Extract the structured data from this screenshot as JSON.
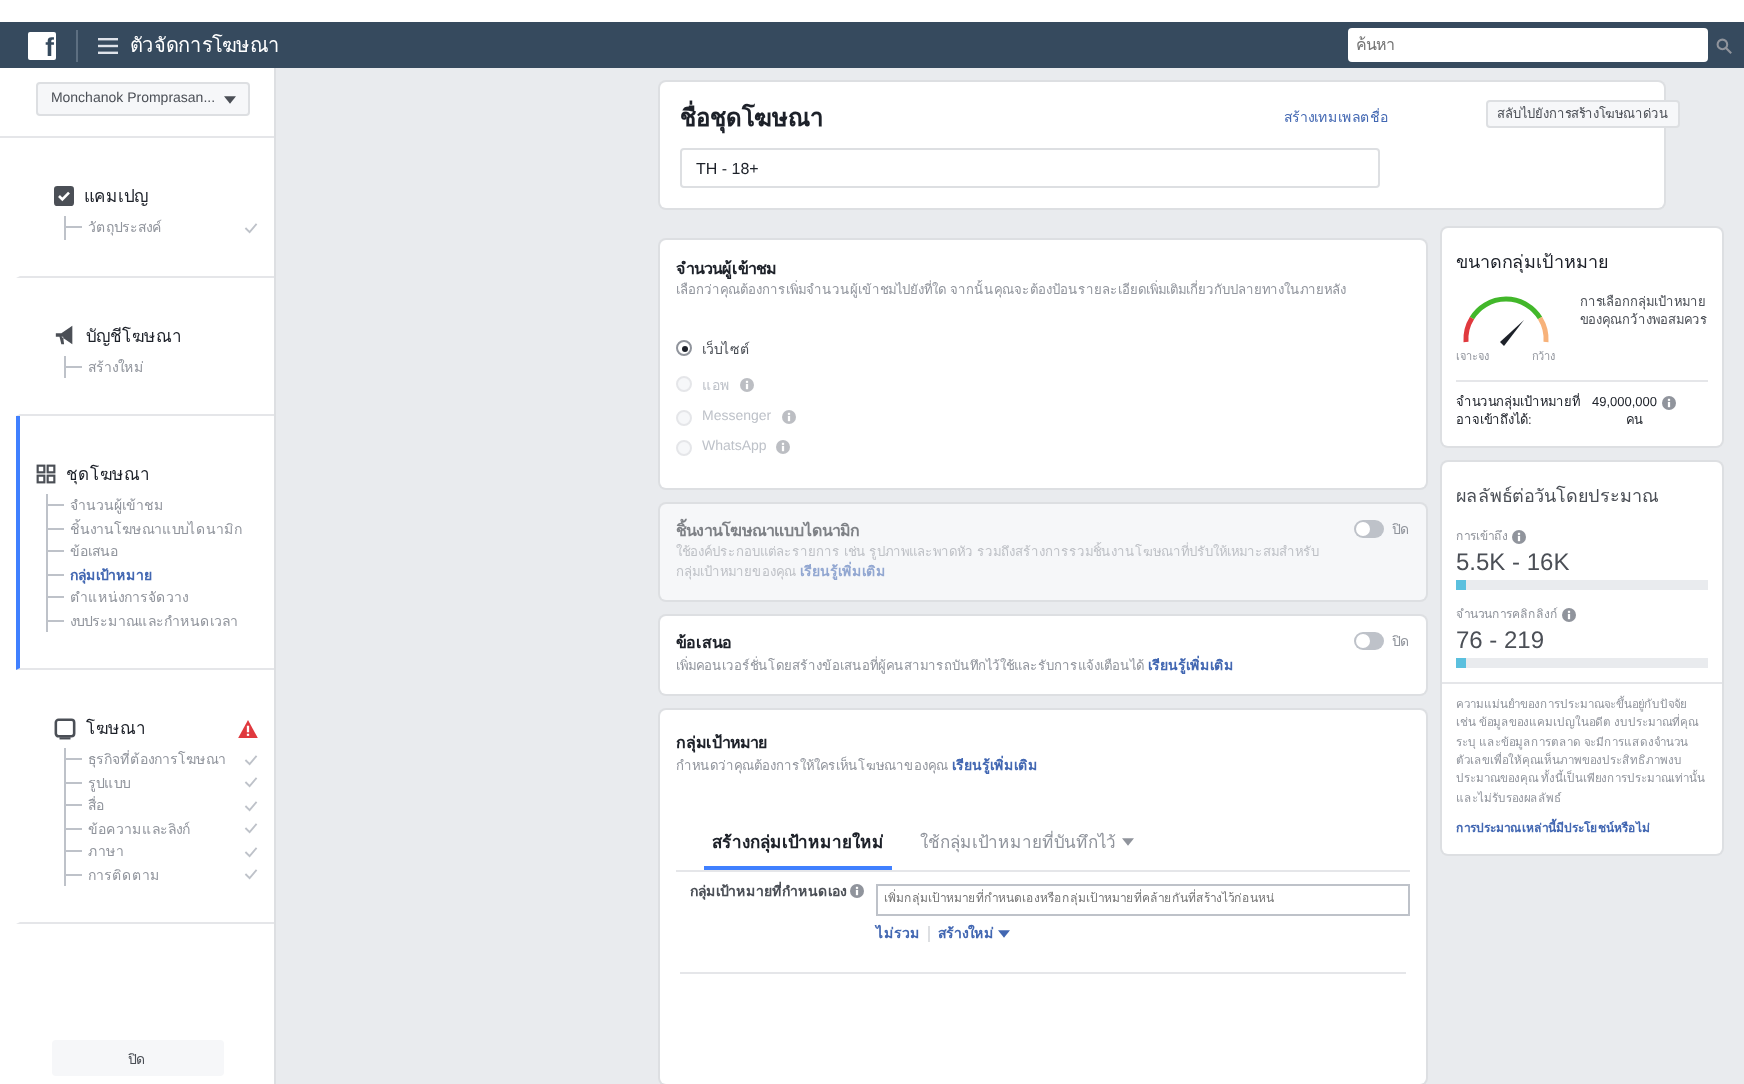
{
  "top_bar": {
    "logo": "f",
    "title": "ตัวจัดการโฆษณา",
    "search": {
      "placeholder": "ค้นหา"
    }
  },
  "sidebar": {
    "account": "Monchanok Promprasan...",
    "sections": [
      {
        "kind": "campaign",
        "title": "แคมเปญ",
        "selected": false,
        "warning": false,
        "items": [
          {
            "label": "วัตถุประสงค์",
            "selected": false,
            "checked": true
          }
        ]
      },
      {
        "kind": "account",
        "title": "บัญชีโฆษณา",
        "selected": false,
        "warning": false,
        "items": [
          {
            "label": "สร้างใหม่",
            "selected": false,
            "checked": false
          }
        ]
      },
      {
        "kind": "adset",
        "title": "ชุดโฆษณา",
        "selected": true,
        "warning": false,
        "items": [
          {
            "label": "จำนวนผู้เข้าชม",
            "selected": false,
            "checked": false
          },
          {
            "label": "ชิ้นงานโฆษณาแบบไดนามิก",
            "selected": false,
            "checked": false
          },
          {
            "label": "ข้อเสนอ",
            "selected": false,
            "checked": false
          },
          {
            "label": "กลุ่มเป้าหมาย",
            "selected": true,
            "checked": false
          },
          {
            "label": "ตำแหน่งการจัดวาง",
            "selected": false,
            "checked": false
          },
          {
            "label": "งบประมาณและกำหนดเวลา",
            "selected": false,
            "checked": false
          }
        ]
      },
      {
        "kind": "ad",
        "title": "โฆษณา",
        "selected": false,
        "warning": true,
        "items": [
          {
            "label": "ธุรกิจที่ต้องการโฆษณา",
            "selected": false,
            "checked": true
          },
          {
            "label": "รูปแบบ",
            "selected": false,
            "checked": true
          },
          {
            "label": "สื่อ",
            "selected": false,
            "checked": true
          },
          {
            "label": "ข้อความและลิงก์",
            "selected": false,
            "checked": true
          },
          {
            "label": "ภาษา",
            "selected": false,
            "checked": true
          },
          {
            "label": "การติดตาม",
            "selected": false,
            "checked": true
          }
        ]
      }
    ],
    "close_button": "ปิด"
  },
  "ad_set_name": {
    "title": "ชื่อชุดโฆษณา",
    "template_link": "สร้างเทมเพลตชื่อ",
    "quick_create_button": "สลับไปยังการสร้างโฆษณาด่วน",
    "value": "TH - 18+"
  },
  "traffic": {
    "title": "จำนวนผู้เข้าชม",
    "description": "เลือกว่าคุณต้องการเพิ่มจำนวนผู้เข้าชมไปยังที่ใด จากนั้นคุณจะต้องป้อนรายละเอียดเพิ่มเติมเกี่ยวกับปลายทางในภายหลัง",
    "options": [
      {
        "label": "เว็บไซต์",
        "selected": true,
        "info": false,
        "disabled": false
      },
      {
        "label": "แอพ",
        "selected": false,
        "info": true,
        "disabled": true
      },
      {
        "label": "Messenger",
        "selected": false,
        "info": true,
        "disabled": true
      },
      {
        "label": "WhatsApp",
        "selected": false,
        "info": true,
        "disabled": true
      }
    ]
  },
  "toggle_cards": [
    {
      "title": "ชิ้นงานโฆษณาแบบไดนามิก",
      "description": "ใช้องค์ประกอบแต่ละรายการ เช่น รูปภาพและพาดหัว รวมถึงสร้างการรวมชิ้นงานโฆษณาที่ปรับให้เหมาะสมสำหรับกลุ่มเป้าหมายของคุณ",
      "link": "เรียนรู้เพิ่มเติม",
      "toggle_label": "ปิด",
      "on": false,
      "disabled": true
    },
    {
      "title": "ข้อเสนอ",
      "description": "เพิ่มคอนเวอร์ชั่นโดยสร้างข้อเสนอที่ผู้คนสามารถบันทึกไว้ใช้และรับการแจ้งเตือนได้",
      "link": "เรียนรู้เพิ่มเติม",
      "toggle_label": "ปิด",
      "on": false,
      "disabled": false
    }
  ],
  "audience": {
    "title": "กลุ่มเป้าหมาย",
    "description": "กำหนดว่าคุณต้องการให้ใครเห็นโฆษณาของคุณ",
    "link": "เรียนรู้เพิ่มเติม",
    "tabs": [
      {
        "label": "สร้างกลุ่มเป้าหมายใหม่",
        "selected": true,
        "dropdown": false
      },
      {
        "label": "ใช้กลุ่มเป้าหมายที่บันทึกไว้",
        "selected": false,
        "dropdown": true
      }
    ],
    "custom_audience": {
      "label": "กลุ่มเป้าหมายที่กำหนดเอง",
      "placeholder": "เพิ่มกลุ่มเป้าหมายที่กำหนดเองหรือกลุ่มเป้าหมายที่คล้ายกันที่สร้างไว้ก่อนหน่",
      "links": [
        {
          "label": "ไม่รวม",
          "dropdown": false
        },
        {
          "label": "สร้างใหม่",
          "dropdown": true
        }
      ]
    }
  },
  "audience_size": {
    "title": "ขนาดกลุ่มเป้าหมาย",
    "gauge_labels": [
      "เจาะจง",
      "กว้าง"
    ],
    "summary": "การเลือกกลุ่มเป้าหมายของคุณกว้างพอสมควร",
    "potential_reach": {
      "label": "จำนวนกลุ่มเป้าหมายที่อาจเข้าถึงได้:",
      "value": "49,000,000",
      "unit": "คน"
    }
  },
  "estimated_results": {
    "title": "ผลลัพธ์ต่อวันโดยประมาณ",
    "metrics": [
      {
        "label": "การเข้าถึง",
        "value": "5.5K - 16K",
        "level": 0.04
      },
      {
        "label": "จำนวนการคลิกลิงก์",
        "value": "76 - 219",
        "level": 0.04
      }
    ],
    "disclaimer": "ความแม่นยำของการประมาณจะขึ้นอยู่กับปัจจัย เช่น ข้อมูลของแคมเปญในอดีต งบประมาณที่คุณระบุ และข้อมูลการตลาด จะมีการแสดงจำนวนตัวเลขเพื่อให้คุณเห็นภาพของประสิทธิภาพงบประมาณของคุณ ทั้งนี้เป็นเพียงการประมาณเท่านั้นและไม่รับรองผลลัพธ์",
    "feedback_link": "การประมาณเหล่านี้มีประโยชน์หรือไม่"
  }
}
